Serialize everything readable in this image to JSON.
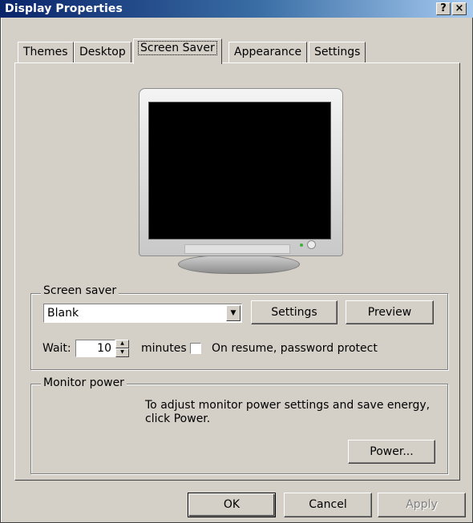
{
  "window": {
    "title": "Display Properties",
    "help_glyph": "?",
    "close_glyph": "×"
  },
  "tabs": [
    {
      "label": "Themes"
    },
    {
      "label": "Desktop"
    },
    {
      "label": "Screen Saver",
      "active": true
    },
    {
      "label": "Appearance"
    },
    {
      "label": "Settings"
    }
  ],
  "screen_saver": {
    "group_label": "Screen saver",
    "selected": "Blank",
    "settings_button": "Settings",
    "preview_button": "Preview",
    "wait_label": "Wait:",
    "wait_value": "10",
    "minutes_label": "minutes",
    "password_checked": false,
    "password_label": "On resume, password protect"
  },
  "monitor_power": {
    "group_label": "Monitor power",
    "description_line1": "To adjust monitor power settings and save energy,",
    "description_line2": "click Power.",
    "power_button": "Power..."
  },
  "footer": {
    "ok": "OK",
    "cancel": "Cancel",
    "apply": "Apply"
  },
  "icons": {
    "monitor": "crt-monitor-icon"
  },
  "colors": {
    "title_start": "#0a246a",
    "title_end": "#a6caf0",
    "face": "#d4d0c8"
  }
}
